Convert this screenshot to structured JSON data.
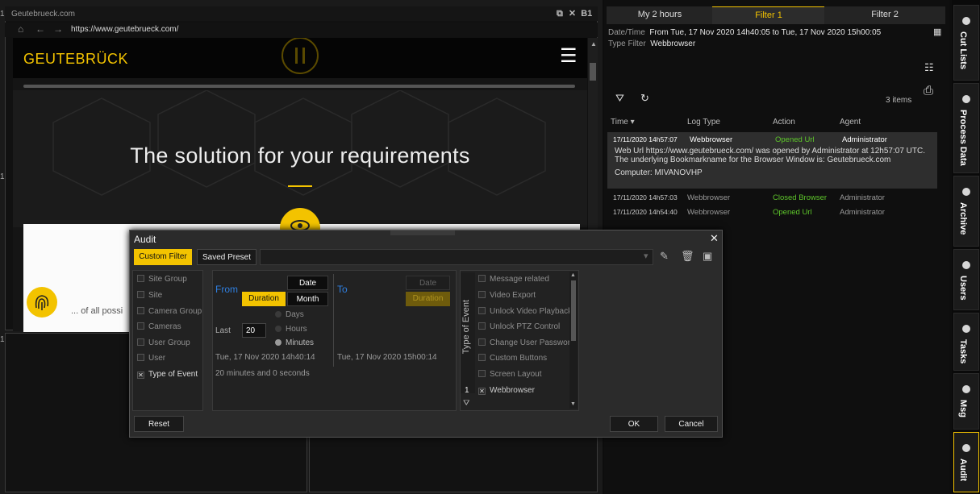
{
  "viewer": {
    "tile_numbers": [
      "1",
      "1",
      "1"
    ],
    "browser": {
      "title": "Geutebrueck.com",
      "controls": "B1",
      "url": "https://www.geutebrueck.com/",
      "logo": "GEUTEBRÜCK",
      "hero_title": "The solution for your requirements",
      "card_text": "... of all possi"
    }
  },
  "panel": {
    "tabs": [
      "My 2 hours",
      "Filter 1",
      "Filter 2"
    ],
    "filter": {
      "datetime_label": "Date/Time",
      "datetime_value": "From Tue, 17 Nov 2020 14h40:05 to Tue, 17 Nov 2020 15h00:05",
      "type_label": "Type Filter",
      "type_value": "Webbrowser"
    },
    "items_count": "3 items",
    "columns": [
      "Time ▾",
      "Log Type",
      "Action",
      "Agent"
    ],
    "rows": [
      {
        "time": "17/11/2020 14h57:07",
        "log_type": "Webbrowser",
        "action": "Opened Url",
        "agent": "Administrator",
        "action_color": "#5ec62b"
      },
      {
        "time": "17/11/2020 14h57:03",
        "log_type": "Webbrowser",
        "action": "Closed Browser",
        "agent": "Administrator",
        "action_color": "#5ec62b"
      },
      {
        "time": "17/11/2020 14h54:40",
        "log_type": "Webbrowser",
        "action": "Opened Url",
        "agent": "Administrator",
        "action_color": "#5ec62b"
      }
    ],
    "detail": "Web Url https://www.geutebrueck.com/ was opened by Administrator at 12h57:07 UTC. The underlying Bookmarkname for the Browser Window is: Geutebrueck.com",
    "computer": "Computer: MIVANOVHP"
  },
  "rail": [
    "Cut Lists",
    "Process Data",
    "Archive",
    "Users",
    "Tasks",
    "Msg",
    "Audit"
  ],
  "modal": {
    "title": "Audit",
    "custom_filter": "Custom Filter",
    "saved_preset": "Saved Preset",
    "categories": [
      {
        "label": "Site Group",
        "checked": false
      },
      {
        "label": "Site",
        "checked": false
      },
      {
        "label": "Camera Group",
        "checked": false
      },
      {
        "label": "Cameras",
        "checked": false
      },
      {
        "label": "User Group",
        "checked": false
      },
      {
        "label": "User",
        "checked": false
      },
      {
        "label": "Type of Event",
        "checked": true
      }
    ],
    "time": {
      "from": "From",
      "to": "To",
      "date": "Date",
      "duration": "Duration",
      "month": "Month",
      "to_date": "Date",
      "to_duration": "Duration",
      "units": [
        "Days",
        "Hours",
        "Minutes"
      ],
      "selected_unit": "Minutes",
      "last_label": "Last",
      "last_value": "20",
      "from_time": "Tue, 17 Nov 2020  14h40:14",
      "to_time": "Tue, 17 Nov 2020  15h00:14",
      "span": "20 minutes and 0 seconds"
    },
    "event_label": "Type of Event",
    "events": [
      {
        "label": "Message related",
        "checked": false
      },
      {
        "label": "Video Export",
        "checked": false
      },
      {
        "label": "Unlock Video Playback",
        "checked": false
      },
      {
        "label": "Unlock PTZ Control",
        "checked": false
      },
      {
        "label": "Change User Password",
        "checked": false
      },
      {
        "label": "Custom Buttons",
        "checked": false
      },
      {
        "label": "Screen Layout",
        "checked": false
      },
      {
        "label": "Webbrowser",
        "checked": true
      }
    ],
    "event_count": "1",
    "reset": "Reset",
    "ok": "OK",
    "cancel": "Cancel"
  },
  "colors": {
    "accent": "#f3c300",
    "link_blue": "#2f7fe0",
    "ok_green": "#5ec62b"
  }
}
